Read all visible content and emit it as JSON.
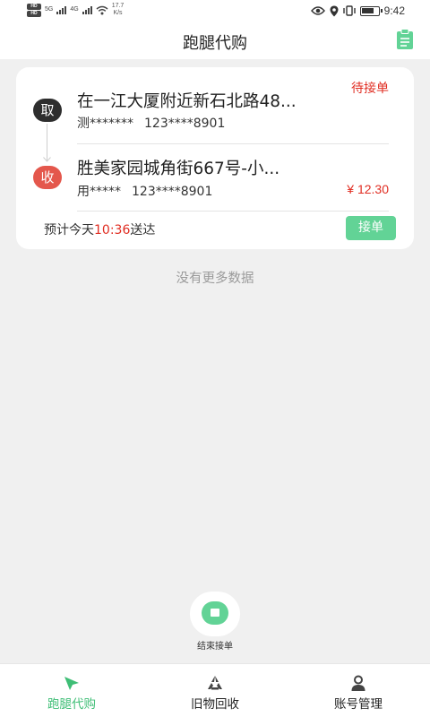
{
  "statusbar": {
    "hd_top": "HD",
    "hd_bottom": "HD",
    "net1": "5G",
    "net2": "4G",
    "speed_value": "17.7",
    "speed_unit": "K/s",
    "time": "9:42"
  },
  "nav": {
    "title": "跑腿代购"
  },
  "order": {
    "status": "待接单",
    "pickup_badge": "取",
    "pickup_address": "在一江大厦附近新石北路48...",
    "pickup_name": "测*******",
    "pickup_phone": "123****8901",
    "receive_badge": "收",
    "receive_address": "胜美家园城角街667号-小...",
    "receive_name": "用*****",
    "receive_phone": "123****8901",
    "price": "¥ 12.30",
    "eta_prefix": "预计今天",
    "eta_time": "10:36",
    "eta_suffix": "送达",
    "accept_label": "接单"
  },
  "list": {
    "no_more": "没有更多数据"
  },
  "fab": {
    "label": "结束接单"
  },
  "tabbar": {
    "items": [
      {
        "label": "跑腿代购",
        "icon": "cursor-arrow-icon",
        "active": true
      },
      {
        "label": "旧物回收",
        "icon": "recycle-icon",
        "active": false
      },
      {
        "label": "账号管理",
        "icon": "user-icon",
        "active": false
      }
    ]
  },
  "colors": {
    "accent_green": "#3fbe76",
    "button_green": "#62d396",
    "alert_red": "#e02d22",
    "badge_dark": "#2e2e2e",
    "badge_red": "#e4574c"
  }
}
